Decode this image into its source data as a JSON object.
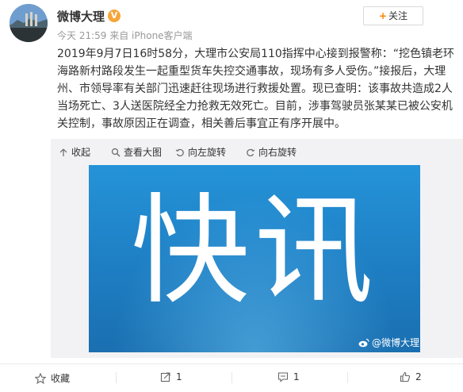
{
  "post": {
    "username": "微博大理",
    "verified_mark": "V",
    "time": "今天 21:59",
    "source": "来自 iPhone客户端",
    "follow_label": "关注",
    "follow_plus": "+",
    "text": "2019年9月7日16时58分，大理市公安局110指挥中心接到报警称：“挖色镇老环海路新村路段发生一起重型货车失控交通事故，现场有多人受伤。”接报后，大理州、市领导率有关部门迅速赶往现场进行救援处置。现已查明：该事故共造成2人当场死亡、3人送医院经全力抢救无效死亡。目前，涉事驾驶员张某某已被公安机关控制，事故原因正在调查，相关善后事宜正有序开展中。"
  },
  "toolbar": {
    "collapse": "收起",
    "view_large": "查看大图",
    "rotate_left": "向左旋转",
    "rotate_right": "向右旋转"
  },
  "image": {
    "text": "快讯",
    "watermark": "@微博大理"
  },
  "footer": {
    "favorite": "收藏",
    "repost_count": "1",
    "comment_count": "1",
    "like_count": "2"
  },
  "colors": {
    "accent": "#ff8200",
    "verified": "#f6a53a",
    "image_bg": "#1e7ec3"
  }
}
